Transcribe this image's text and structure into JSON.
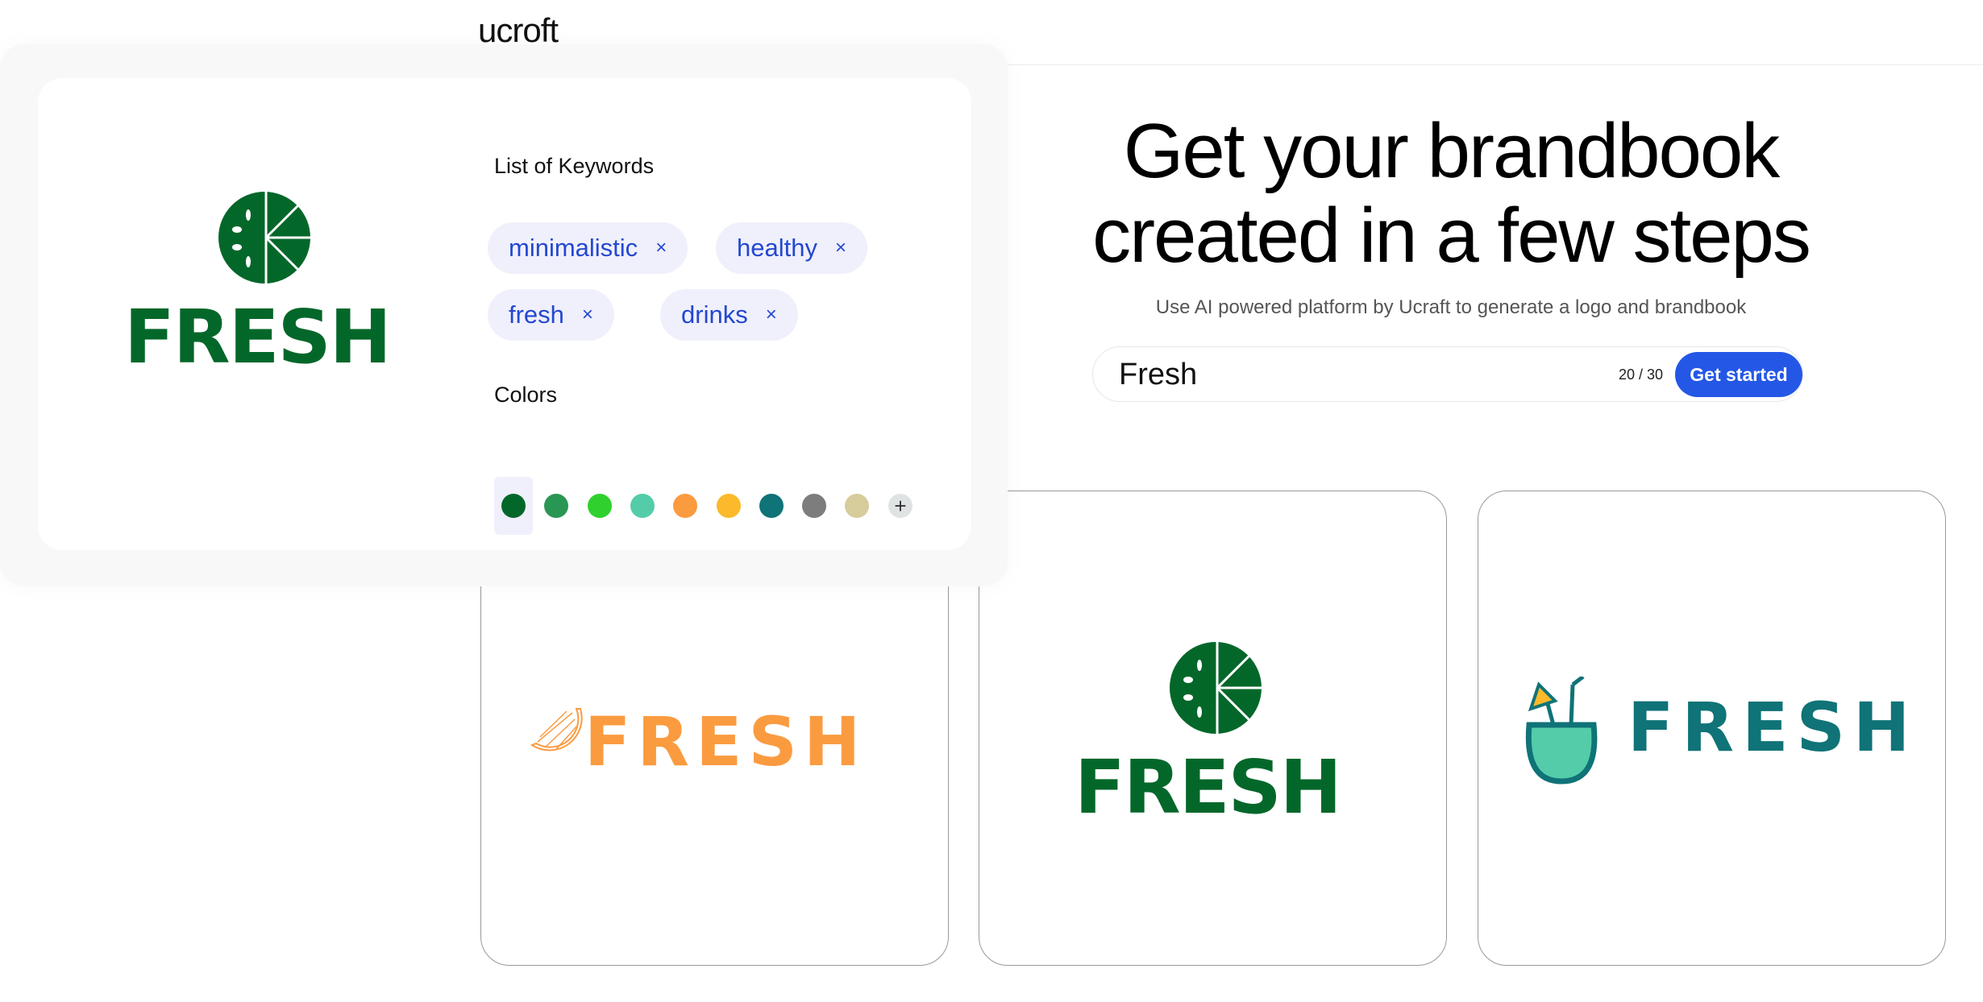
{
  "header": {
    "brand": "ucroft"
  },
  "hero": {
    "headline_1": "Get your brandbook",
    "headline_2": "created in a few steps",
    "subtitle": "Use AI powered platform by Ucraft to generate a logo and brandbook"
  },
  "search": {
    "value": "Fresh",
    "counter": "20 / 30",
    "button": "Get started"
  },
  "panel": {
    "keywords_label": "List of Keywords",
    "keywords": [
      "minimalistic",
      "healthy",
      "fresh",
      "drinks"
    ],
    "remove_icon": "×",
    "colors_label": "Colors",
    "colors": [
      "#04672a",
      "#2a9654",
      "#2fd12f",
      "#54ccaa",
      "#fb9b40",
      "#fbb92b",
      "#0f7377",
      "#7d7d7d",
      "#d6cc9c"
    ],
    "add_icon": "+",
    "selected_color_index": 0,
    "logo_text": "FRESH"
  },
  "cards": [
    {
      "logo_text": "FRESH",
      "color": "#fb9b40",
      "icon": "orange-slice-icon"
    },
    {
      "logo_text": "FRESH",
      "color": "#04672a",
      "icon": "lime-icon"
    },
    {
      "logo_text": "FRESH",
      "color": "#0f7377",
      "icon": "coconut-drink-icon"
    }
  ]
}
